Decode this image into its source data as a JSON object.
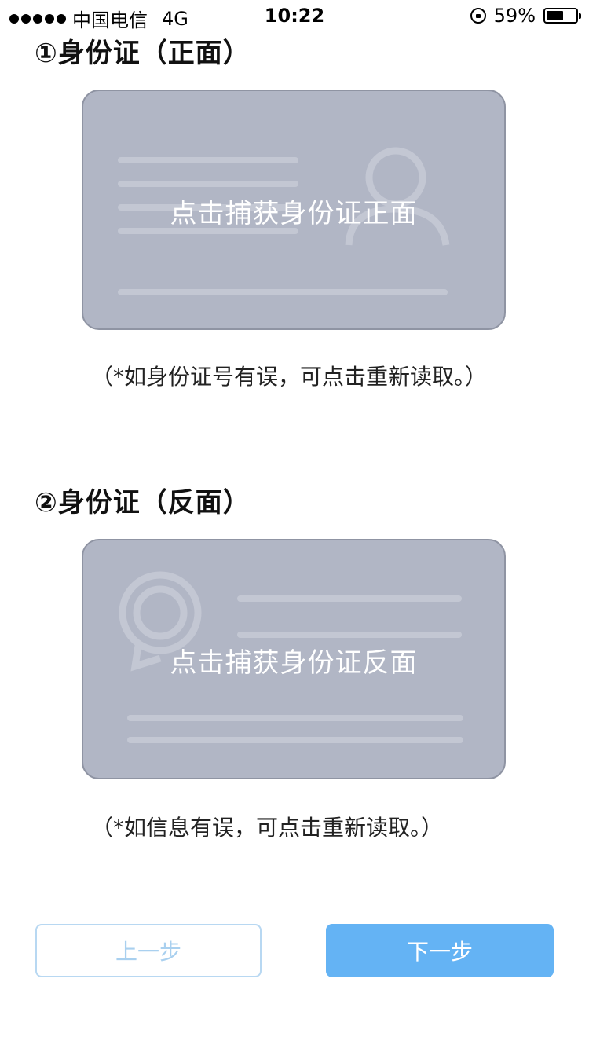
{
  "status_bar": {
    "carrier": "中国电信",
    "network": "4G",
    "time": "10:22",
    "battery_percent": "59%",
    "battery_level": 0.59
  },
  "front": {
    "title": "①身份证（正面）",
    "card_label": "点击捕获身份证正面",
    "note": "（*如身份证号有误，可点击重新读取。）"
  },
  "back": {
    "title": "②身份证（反面）",
    "card_label": "点击捕获身份证反面",
    "note": "（*如信息有误，可点击重新读取。）"
  },
  "buttons": {
    "prev_label": "上一步",
    "next_label": "下一步"
  },
  "colors": {
    "card_bg": "#b1b6c5",
    "primary_button": "#64b3f4",
    "secondary_button_text": "#a9d0ef"
  }
}
